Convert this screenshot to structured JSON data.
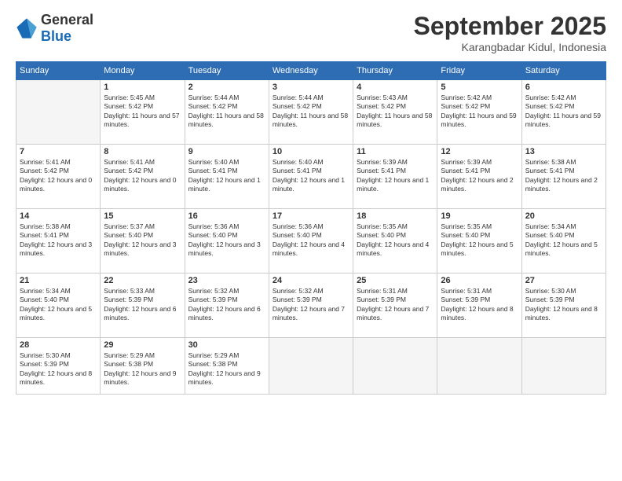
{
  "header": {
    "logo": {
      "general": "General",
      "blue": "Blue"
    },
    "title": "September 2025",
    "location": "Karangbadar Kidul, Indonesia"
  },
  "days_header": [
    "Sunday",
    "Monday",
    "Tuesday",
    "Wednesday",
    "Thursday",
    "Friday",
    "Saturday"
  ],
  "weeks": [
    [
      {
        "day": "",
        "empty": true
      },
      {
        "day": "1",
        "sunrise": "Sunrise: 5:45 AM",
        "sunset": "Sunset: 5:42 PM",
        "daylight": "Daylight: 11 hours and 57 minutes."
      },
      {
        "day": "2",
        "sunrise": "Sunrise: 5:44 AM",
        "sunset": "Sunset: 5:42 PM",
        "daylight": "Daylight: 11 hours and 58 minutes."
      },
      {
        "day": "3",
        "sunrise": "Sunrise: 5:44 AM",
        "sunset": "Sunset: 5:42 PM",
        "daylight": "Daylight: 11 hours and 58 minutes."
      },
      {
        "day": "4",
        "sunrise": "Sunrise: 5:43 AM",
        "sunset": "Sunset: 5:42 PM",
        "daylight": "Daylight: 11 hours and 58 minutes."
      },
      {
        "day": "5",
        "sunrise": "Sunrise: 5:42 AM",
        "sunset": "Sunset: 5:42 PM",
        "daylight": "Daylight: 11 hours and 59 minutes."
      },
      {
        "day": "6",
        "sunrise": "Sunrise: 5:42 AM",
        "sunset": "Sunset: 5:42 PM",
        "daylight": "Daylight: 11 hours and 59 minutes."
      }
    ],
    [
      {
        "day": "7",
        "sunrise": "Sunrise: 5:41 AM",
        "sunset": "Sunset: 5:42 PM",
        "daylight": "Daylight: 12 hours and 0 minutes."
      },
      {
        "day": "8",
        "sunrise": "Sunrise: 5:41 AM",
        "sunset": "Sunset: 5:42 PM",
        "daylight": "Daylight: 12 hours and 0 minutes."
      },
      {
        "day": "9",
        "sunrise": "Sunrise: 5:40 AM",
        "sunset": "Sunset: 5:41 PM",
        "daylight": "Daylight: 12 hours and 1 minute."
      },
      {
        "day": "10",
        "sunrise": "Sunrise: 5:40 AM",
        "sunset": "Sunset: 5:41 PM",
        "daylight": "Daylight: 12 hours and 1 minute."
      },
      {
        "day": "11",
        "sunrise": "Sunrise: 5:39 AM",
        "sunset": "Sunset: 5:41 PM",
        "daylight": "Daylight: 12 hours and 1 minute."
      },
      {
        "day": "12",
        "sunrise": "Sunrise: 5:39 AM",
        "sunset": "Sunset: 5:41 PM",
        "daylight": "Daylight: 12 hours and 2 minutes."
      },
      {
        "day": "13",
        "sunrise": "Sunrise: 5:38 AM",
        "sunset": "Sunset: 5:41 PM",
        "daylight": "Daylight: 12 hours and 2 minutes."
      }
    ],
    [
      {
        "day": "14",
        "sunrise": "Sunrise: 5:38 AM",
        "sunset": "Sunset: 5:41 PM",
        "daylight": "Daylight: 12 hours and 3 minutes."
      },
      {
        "day": "15",
        "sunrise": "Sunrise: 5:37 AM",
        "sunset": "Sunset: 5:40 PM",
        "daylight": "Daylight: 12 hours and 3 minutes."
      },
      {
        "day": "16",
        "sunrise": "Sunrise: 5:36 AM",
        "sunset": "Sunset: 5:40 PM",
        "daylight": "Daylight: 12 hours and 3 minutes."
      },
      {
        "day": "17",
        "sunrise": "Sunrise: 5:36 AM",
        "sunset": "Sunset: 5:40 PM",
        "daylight": "Daylight: 12 hours and 4 minutes."
      },
      {
        "day": "18",
        "sunrise": "Sunrise: 5:35 AM",
        "sunset": "Sunset: 5:40 PM",
        "daylight": "Daylight: 12 hours and 4 minutes."
      },
      {
        "day": "19",
        "sunrise": "Sunrise: 5:35 AM",
        "sunset": "Sunset: 5:40 PM",
        "daylight": "Daylight: 12 hours and 5 minutes."
      },
      {
        "day": "20",
        "sunrise": "Sunrise: 5:34 AM",
        "sunset": "Sunset: 5:40 PM",
        "daylight": "Daylight: 12 hours and 5 minutes."
      }
    ],
    [
      {
        "day": "21",
        "sunrise": "Sunrise: 5:34 AM",
        "sunset": "Sunset: 5:40 PM",
        "daylight": "Daylight: 12 hours and 5 minutes."
      },
      {
        "day": "22",
        "sunrise": "Sunrise: 5:33 AM",
        "sunset": "Sunset: 5:39 PM",
        "daylight": "Daylight: 12 hours and 6 minutes."
      },
      {
        "day": "23",
        "sunrise": "Sunrise: 5:32 AM",
        "sunset": "Sunset: 5:39 PM",
        "daylight": "Daylight: 12 hours and 6 minutes."
      },
      {
        "day": "24",
        "sunrise": "Sunrise: 5:32 AM",
        "sunset": "Sunset: 5:39 PM",
        "daylight": "Daylight: 12 hours and 7 minutes."
      },
      {
        "day": "25",
        "sunrise": "Sunrise: 5:31 AM",
        "sunset": "Sunset: 5:39 PM",
        "daylight": "Daylight: 12 hours and 7 minutes."
      },
      {
        "day": "26",
        "sunrise": "Sunrise: 5:31 AM",
        "sunset": "Sunset: 5:39 PM",
        "daylight": "Daylight: 12 hours and 8 minutes."
      },
      {
        "day": "27",
        "sunrise": "Sunrise: 5:30 AM",
        "sunset": "Sunset: 5:39 PM",
        "daylight": "Daylight: 12 hours and 8 minutes."
      }
    ],
    [
      {
        "day": "28",
        "sunrise": "Sunrise: 5:30 AM",
        "sunset": "Sunset: 5:39 PM",
        "daylight": "Daylight: 12 hours and 8 minutes."
      },
      {
        "day": "29",
        "sunrise": "Sunrise: 5:29 AM",
        "sunset": "Sunset: 5:38 PM",
        "daylight": "Daylight: 12 hours and 9 minutes."
      },
      {
        "day": "30",
        "sunrise": "Sunrise: 5:29 AM",
        "sunset": "Sunset: 5:38 PM",
        "daylight": "Daylight: 12 hours and 9 minutes."
      },
      {
        "day": "",
        "empty": true
      },
      {
        "day": "",
        "empty": true
      },
      {
        "day": "",
        "empty": true
      },
      {
        "day": "",
        "empty": true
      }
    ]
  ]
}
